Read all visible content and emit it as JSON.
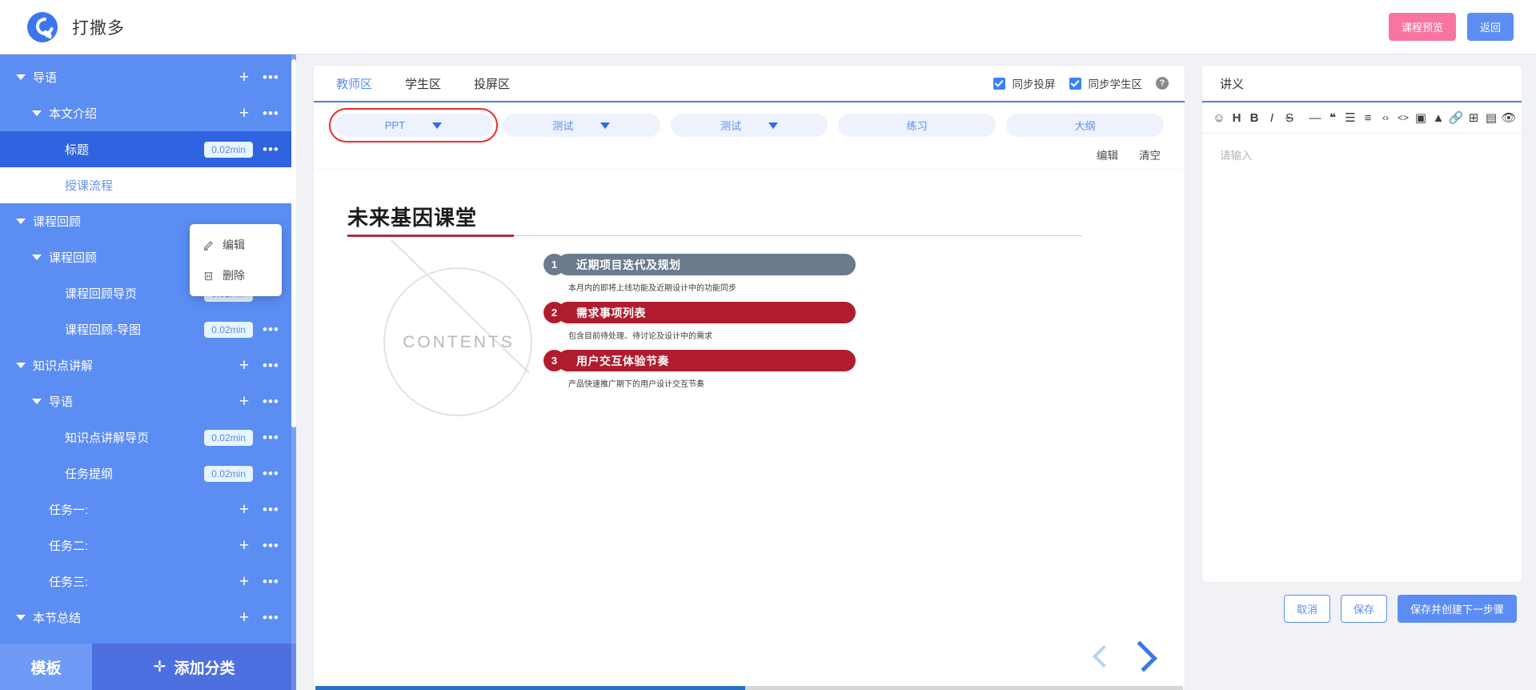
{
  "topbar": {
    "app_title": "打撒多",
    "logo_icon": "brand-logo-icon",
    "preview_label": "课程预览",
    "back_label": "返回"
  },
  "sidebar": {
    "tree": [
      {
        "level": 0,
        "label": "导语",
        "caret": true,
        "duration": null,
        "plus": true,
        "dots": true,
        "state": "normal"
      },
      {
        "level": 1,
        "label": "本文介绍",
        "caret": true,
        "duration": null,
        "plus": true,
        "dots": true,
        "state": "normal"
      },
      {
        "level": 2,
        "label": "标题",
        "caret": false,
        "duration": "0.02min",
        "plus": false,
        "dots": true,
        "state": "selected"
      },
      {
        "level": 2,
        "label": "授课流程",
        "caret": false,
        "duration": null,
        "plus": false,
        "dots": false,
        "state": "white"
      },
      {
        "level": 0,
        "label": "课程回顾",
        "caret": true,
        "duration": null,
        "plus": false,
        "dots": false,
        "state": "normal"
      },
      {
        "level": 1,
        "label": "课程回顾",
        "caret": true,
        "duration": null,
        "plus": true,
        "dots": true,
        "state": "normal"
      },
      {
        "level": 2,
        "label": "课程回顾导页",
        "caret": false,
        "duration": "0.02min",
        "plus": false,
        "dots": true,
        "state": "normal"
      },
      {
        "level": 2,
        "label": "课程回顾-导图",
        "caret": false,
        "duration": "0.02min",
        "plus": false,
        "dots": true,
        "state": "normal"
      },
      {
        "level": 0,
        "label": "知识点讲解",
        "caret": true,
        "duration": null,
        "plus": true,
        "dots": true,
        "state": "normal"
      },
      {
        "level": 1,
        "label": "导语",
        "caret": true,
        "duration": null,
        "plus": true,
        "dots": true,
        "state": "normal"
      },
      {
        "level": 2,
        "label": "知识点讲解导页",
        "caret": false,
        "duration": "0.02min",
        "plus": false,
        "dots": true,
        "state": "normal"
      },
      {
        "level": 2,
        "label": "任务提纲",
        "caret": false,
        "duration": "0.02min",
        "plus": false,
        "dots": true,
        "state": "normal"
      },
      {
        "level": 1,
        "label": "任务一:",
        "caret": false,
        "duration": null,
        "plus": true,
        "dots": true,
        "state": "normal"
      },
      {
        "level": 1,
        "label": "任务二:",
        "caret": false,
        "duration": null,
        "plus": true,
        "dots": true,
        "state": "normal"
      },
      {
        "level": 1,
        "label": "任务三:",
        "caret": false,
        "duration": null,
        "plus": true,
        "dots": true,
        "state": "normal"
      },
      {
        "level": 0,
        "label": "本节总结",
        "caret": true,
        "duration": null,
        "plus": true,
        "dots": true,
        "state": "normal"
      }
    ],
    "context_menu": {
      "edit_label": "编辑",
      "delete_label": "删除",
      "edit_icon": "pencil-icon",
      "delete_icon": "trash-icon"
    },
    "footer": {
      "template_label": "模板",
      "add_category_label": "添加分类",
      "add_icon": "plus-icon"
    }
  },
  "center": {
    "tabs": [
      {
        "label": "教师区",
        "active": true
      },
      {
        "label": "学生区",
        "active": false
      },
      {
        "label": "投屏区",
        "active": false
      }
    ],
    "sync": {
      "screen_label": "同步投屏",
      "screen_checked": true,
      "student_label": "同步学生区",
      "student_checked": true,
      "help_icon": "question-mark-icon",
      "help_glyph": "?"
    },
    "pills": [
      {
        "label": "PPT",
        "has_dropdown": true,
        "selected": true
      },
      {
        "label": "测试",
        "has_dropdown": true,
        "selected": false
      },
      {
        "label": "测试",
        "has_dropdown": true,
        "selected": false
      },
      {
        "label": "练习",
        "has_dropdown": false,
        "selected": false
      },
      {
        "label": "大纲",
        "has_dropdown": false,
        "selected": false
      }
    ],
    "actions": [
      {
        "label": "编辑"
      },
      {
        "label": "清空"
      }
    ],
    "slide": {
      "title": "未来基因课堂",
      "contents_word": "CONTENTS",
      "items": [
        {
          "num": "1",
          "title": "近期项目迭代及规划",
          "desc": "本月内的即将上线功能及近期设计中的功能同步",
          "color": "#6b7a8c"
        },
        {
          "num": "2",
          "title": "需求事项列表",
          "desc": "包含目前待处理、待讨论及设计中的需求",
          "color": "#b01c2e"
        },
        {
          "num": "3",
          "title": "用户交互体验节奏",
          "desc": "产品快速推广期下的用户设计交互节奏",
          "color": "#b01c2e"
        }
      ],
      "prev_icon": "chevron-left-icon",
      "next_icon": "chevron-right-icon",
      "progress_percent": 49.5
    }
  },
  "right": {
    "panel_title": "讲义",
    "toolbar": [
      {
        "icon": "emoji-icon",
        "glyph": "☺",
        "gap": false
      },
      {
        "icon": "heading-icon",
        "glyph": "H",
        "gap": false
      },
      {
        "icon": "bold-icon",
        "glyph": "B",
        "gap": false
      },
      {
        "icon": "italic-icon",
        "glyph": "I",
        "gap": false
      },
      {
        "icon": "strikethrough-icon",
        "glyph": "S",
        "gap": false
      },
      {
        "icon": "horizontal-rule-icon",
        "glyph": "—",
        "gap": true
      },
      {
        "icon": "quote-icon",
        "glyph": "❝",
        "gap": false
      },
      {
        "icon": "bullet-list-icon",
        "glyph": "☰",
        "gap": false
      },
      {
        "icon": "numbered-list-icon",
        "glyph": "≡",
        "gap": false
      },
      {
        "icon": "inline-code-icon",
        "glyph": "‹›",
        "gap": false
      },
      {
        "icon": "code-block-icon",
        "glyph": "<>",
        "gap": false
      },
      {
        "icon": "image-icon",
        "glyph": "▣",
        "gap": false
      },
      {
        "icon": "video-icon",
        "glyph": "▲",
        "gap": false
      },
      {
        "icon": "link-icon",
        "glyph": "🔗",
        "gap": false
      },
      {
        "icon": "table-icon",
        "glyph": "⊞",
        "gap": false
      },
      {
        "icon": "layout-icon",
        "glyph": "▤",
        "gap": false
      },
      {
        "icon": "preview-eye-icon",
        "glyph": "👁",
        "gap": false
      },
      {
        "icon": "fullscreen-icon",
        "glyph": "⤢",
        "gap": false
      },
      {
        "icon": "help-icon",
        "glyph": "?",
        "gap": false
      }
    ],
    "editor_placeholder": "请输入",
    "footer_buttons": [
      {
        "label": "取消",
        "primary": false
      },
      {
        "label": "保存",
        "primary": false
      },
      {
        "label": "保存并创建下一步骤",
        "primary": true
      }
    ]
  }
}
